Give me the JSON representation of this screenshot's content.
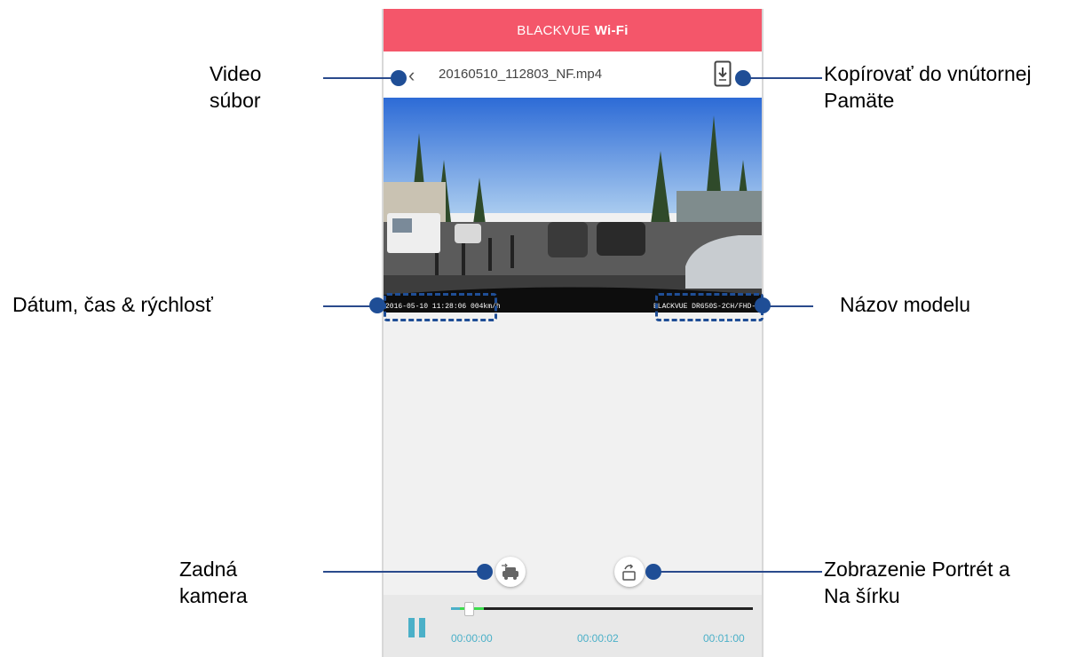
{
  "app": {
    "brand": "BLACKVUE",
    "brand_suffix": "Wi-Fi"
  },
  "file": {
    "back_icon": "chevron-left-icon",
    "name": "20160510_112803_NF.mp4",
    "copy_icon": "phone-download-icon"
  },
  "video": {
    "osd_left": "2016-05-10 11:28:06  004km/h",
    "osd_right": "BLACKVUE DR650S-2CH/FHD-H"
  },
  "buttons": {
    "rear_icon": "car-swap-icon",
    "rotate_icon": "rotate-screen-icon"
  },
  "player": {
    "pause_icon": "pause-icon",
    "current_time": "00:00:00",
    "buffered_time": "00:00:02",
    "total_time": "00:01:00",
    "progress_fraction": 0.03,
    "buffered_fraction": 0.11
  },
  "callouts": {
    "video_file": [
      "Video",
      "súbor"
    ],
    "copy": [
      "Kopírovať do vnútornej",
      "Pamäte"
    ],
    "datetime": "Dátum, čas & rýchlosť",
    "model": "Názov modelu",
    "rear": [
      "Zadná",
      "kamera"
    ],
    "orientation": [
      "Zobrazenie Portrét a",
      "Na šírku"
    ]
  },
  "colors": {
    "appbar": "#f4566a",
    "accent": "#4bb0c8",
    "callout": "#1f4e96"
  }
}
